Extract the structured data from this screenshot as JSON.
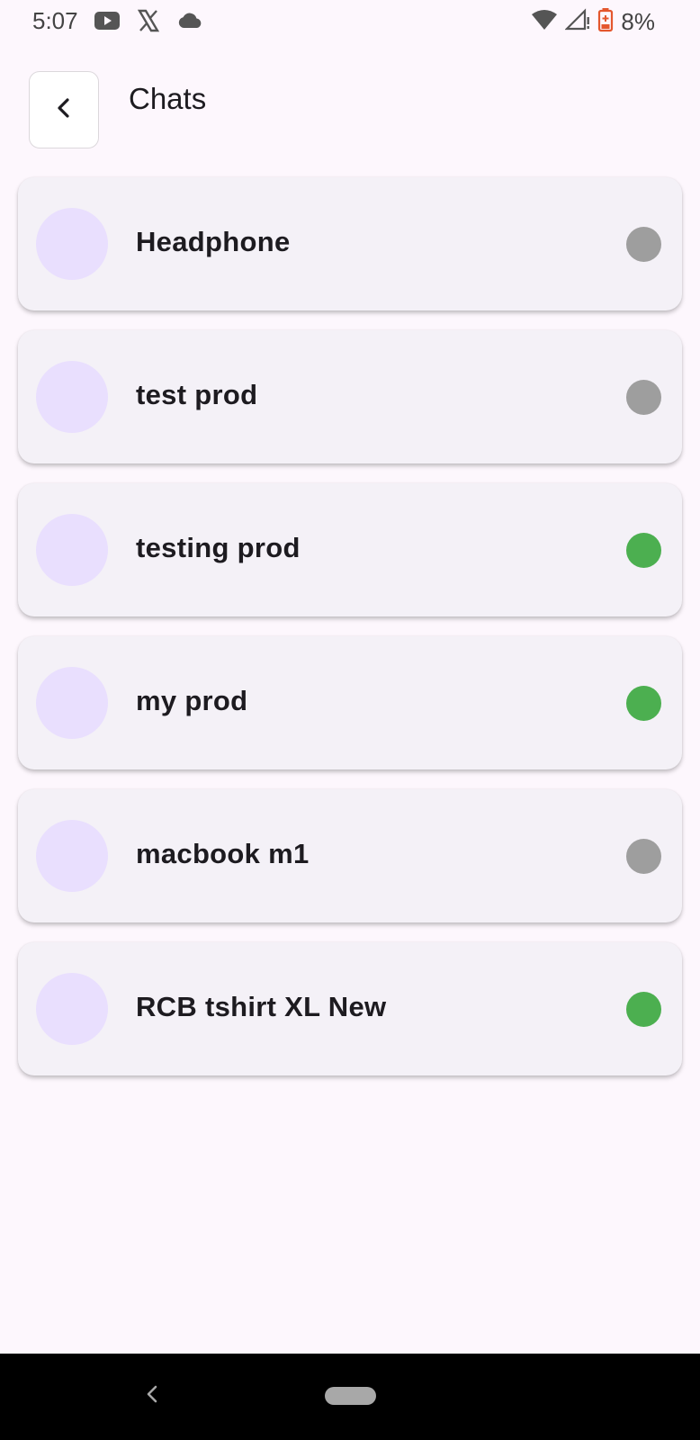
{
  "status_bar": {
    "time": "5:07",
    "left_icons": [
      "youtube-icon",
      "x-icon",
      "cloud-icon"
    ],
    "right_icons": [
      "wifi-icon",
      "cellular-signal-icon",
      "battery-icon"
    ],
    "battery": "8%"
  },
  "header": {
    "back_icon": "chevron-left-icon",
    "title": "Chats"
  },
  "chats": [
    {
      "name": "Headphone",
      "status": "offline",
      "status_color": "#9e9e9e"
    },
    {
      "name": "test prod",
      "status": "offline",
      "status_color": "#9e9e9e"
    },
    {
      "name": "testing prod",
      "status": "online",
      "status_color": "#4caf50"
    },
    {
      "name": "my prod",
      "status": "online",
      "status_color": "#4caf50"
    },
    {
      "name": "macbook m1",
      "status": "offline",
      "status_color": "#9e9e9e"
    },
    {
      "name": "RCB tshirt XL New",
      "status": "online",
      "status_color": "#4caf50"
    }
  ],
  "colors": {
    "background": "#fdf7fd",
    "card": "#f4f1f7",
    "avatar": "#e9dffe",
    "online": "#4caf50",
    "offline": "#9e9e9e",
    "battery_warning": "#e4572e"
  },
  "nav_bar": {
    "back_icon": "nav-back-icon",
    "home_icon": "home-pill-icon"
  }
}
